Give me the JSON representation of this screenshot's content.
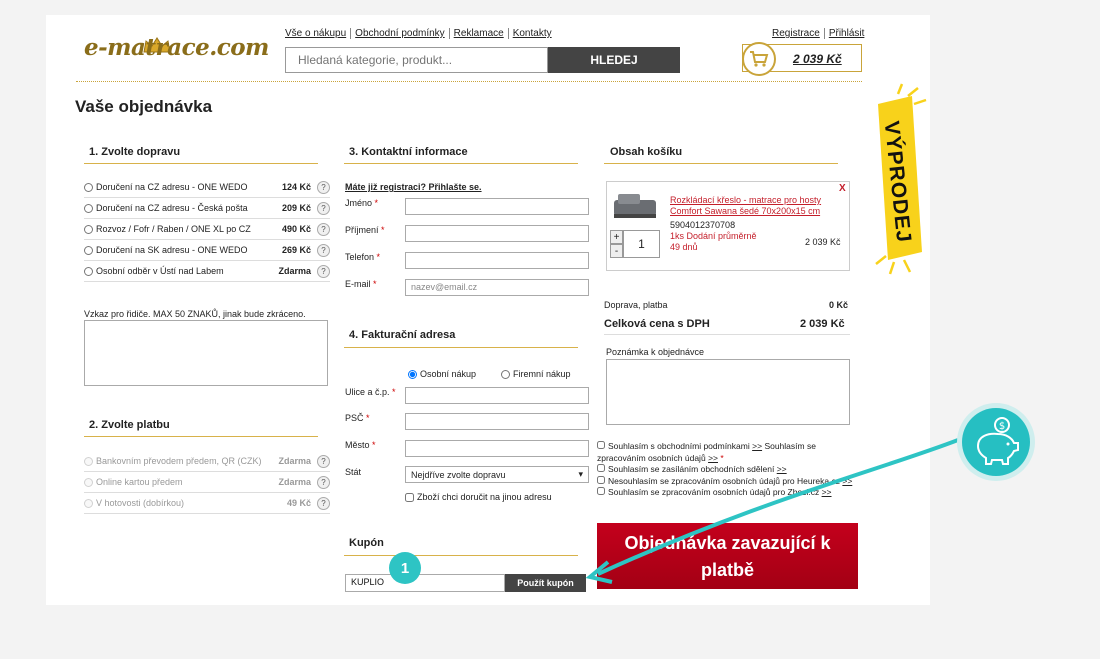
{
  "header": {
    "logo": "e-matrace.com",
    "nav": [
      "Vše o nákupu",
      "Obchodní podmínky",
      "Reklamace",
      "Kontakty"
    ],
    "user_nav": [
      "Registrace",
      "Přihlásit"
    ],
    "search_placeholder": "Hledaná kategorie, produkt...",
    "search_button": "HLEDEJ",
    "cart_total": "2 039 Kč"
  },
  "title": "Vaše objednávka",
  "shipping": {
    "heading": "1. Zvolte dopravu",
    "options": [
      {
        "label": "Doručení na CZ adresu - ONE WEDO",
        "price": "124 Kč"
      },
      {
        "label": "Doručení na CZ adresu - Česká pošta",
        "price": "209 Kč"
      },
      {
        "label": "Rozvoz / Fofr / Raben / ONE XL po CZ",
        "price": "490 Kč"
      },
      {
        "label": "Doručení na SK adresu - ONE WEDO",
        "price": "269 Kč"
      },
      {
        "label": "Osobní odběr v Ústí nad Labem",
        "price": "Zdarma"
      }
    ],
    "note_label": "Vzkaz pro řidiče. MAX 50 ZNAKŮ, jinak bude zkráceno."
  },
  "payment": {
    "heading": "2. Zvolte platbu",
    "options": [
      {
        "label": "Bankovním převodem předem, QR (CZK)",
        "price": "Zdarma"
      },
      {
        "label": "Online kartou předem",
        "price": "Zdarma"
      },
      {
        "label": "V hotovosti (dobírkou)",
        "price": "49 Kč"
      }
    ]
  },
  "contact": {
    "heading": "3. Kontaktní informace",
    "login_link": "Máte již registraci? Přihlašte se.",
    "fields": [
      "Jméno",
      "Příjmení",
      "Telefon",
      "E-mail"
    ],
    "email_placeholder": "nazev@email.cz"
  },
  "billing": {
    "heading": "4. Fakturační adresa",
    "radio_personal": "Osobní nákup",
    "radio_company": "Firemní nákup",
    "fields": [
      "Ulice a č.p.",
      "PSČ",
      "Město"
    ],
    "country_label": "Stát",
    "country_value": "Nejdříve zvolte dopravu",
    "other_address": "Zboží chci doručit na jinou adresu"
  },
  "coupon": {
    "heading": "Kupón",
    "value": "KUPLIO",
    "button": "Použít kupón"
  },
  "cart": {
    "heading": "Obsah košíku",
    "item_name": "Rozkládací křeslo - matrace pro hosty Comfort Sawana šedé 70x200x15 cm",
    "item_code": "5904012370708",
    "item_availability": "1ks Dodání průměrně 49 dnů",
    "item_qty": "1",
    "item_price": "2 039 Kč",
    "remove": "X",
    "shipping_label": "Doprava, platba",
    "shipping_value": "0 Kč",
    "total_label": "Celková cena s DPH",
    "total_value": "2 039 Kč",
    "note_label": "Poznámka k objednávce"
  },
  "consents": [
    {
      "text": "Souhlasím s obchodními podmínkami",
      "link": ">>",
      "text2": "Souhlasím se zpracováním osobních údajů",
      "link2": ">>",
      "star": "*"
    },
    {
      "text": "Souhlasím se zasíláním obchodních sdělení",
      "link": ">>"
    },
    {
      "text": "Nesouhlasím se zpracováním osobních údajů pro Heureka.cz",
      "link": ">>"
    },
    {
      "text": "Souhlasím se zpracováním osobních údajů pro Zbozi.cz",
      "link": ">>"
    }
  ],
  "submit": "Objednávka zavazující k platbě",
  "sale_banner": "VÝPRODEJ",
  "annotation_number": "1",
  "colors": {
    "accent": "#c9a43a",
    "submit": "#b8001a",
    "annotation": "#2ec4c4",
    "sale": "#f8d21b"
  }
}
